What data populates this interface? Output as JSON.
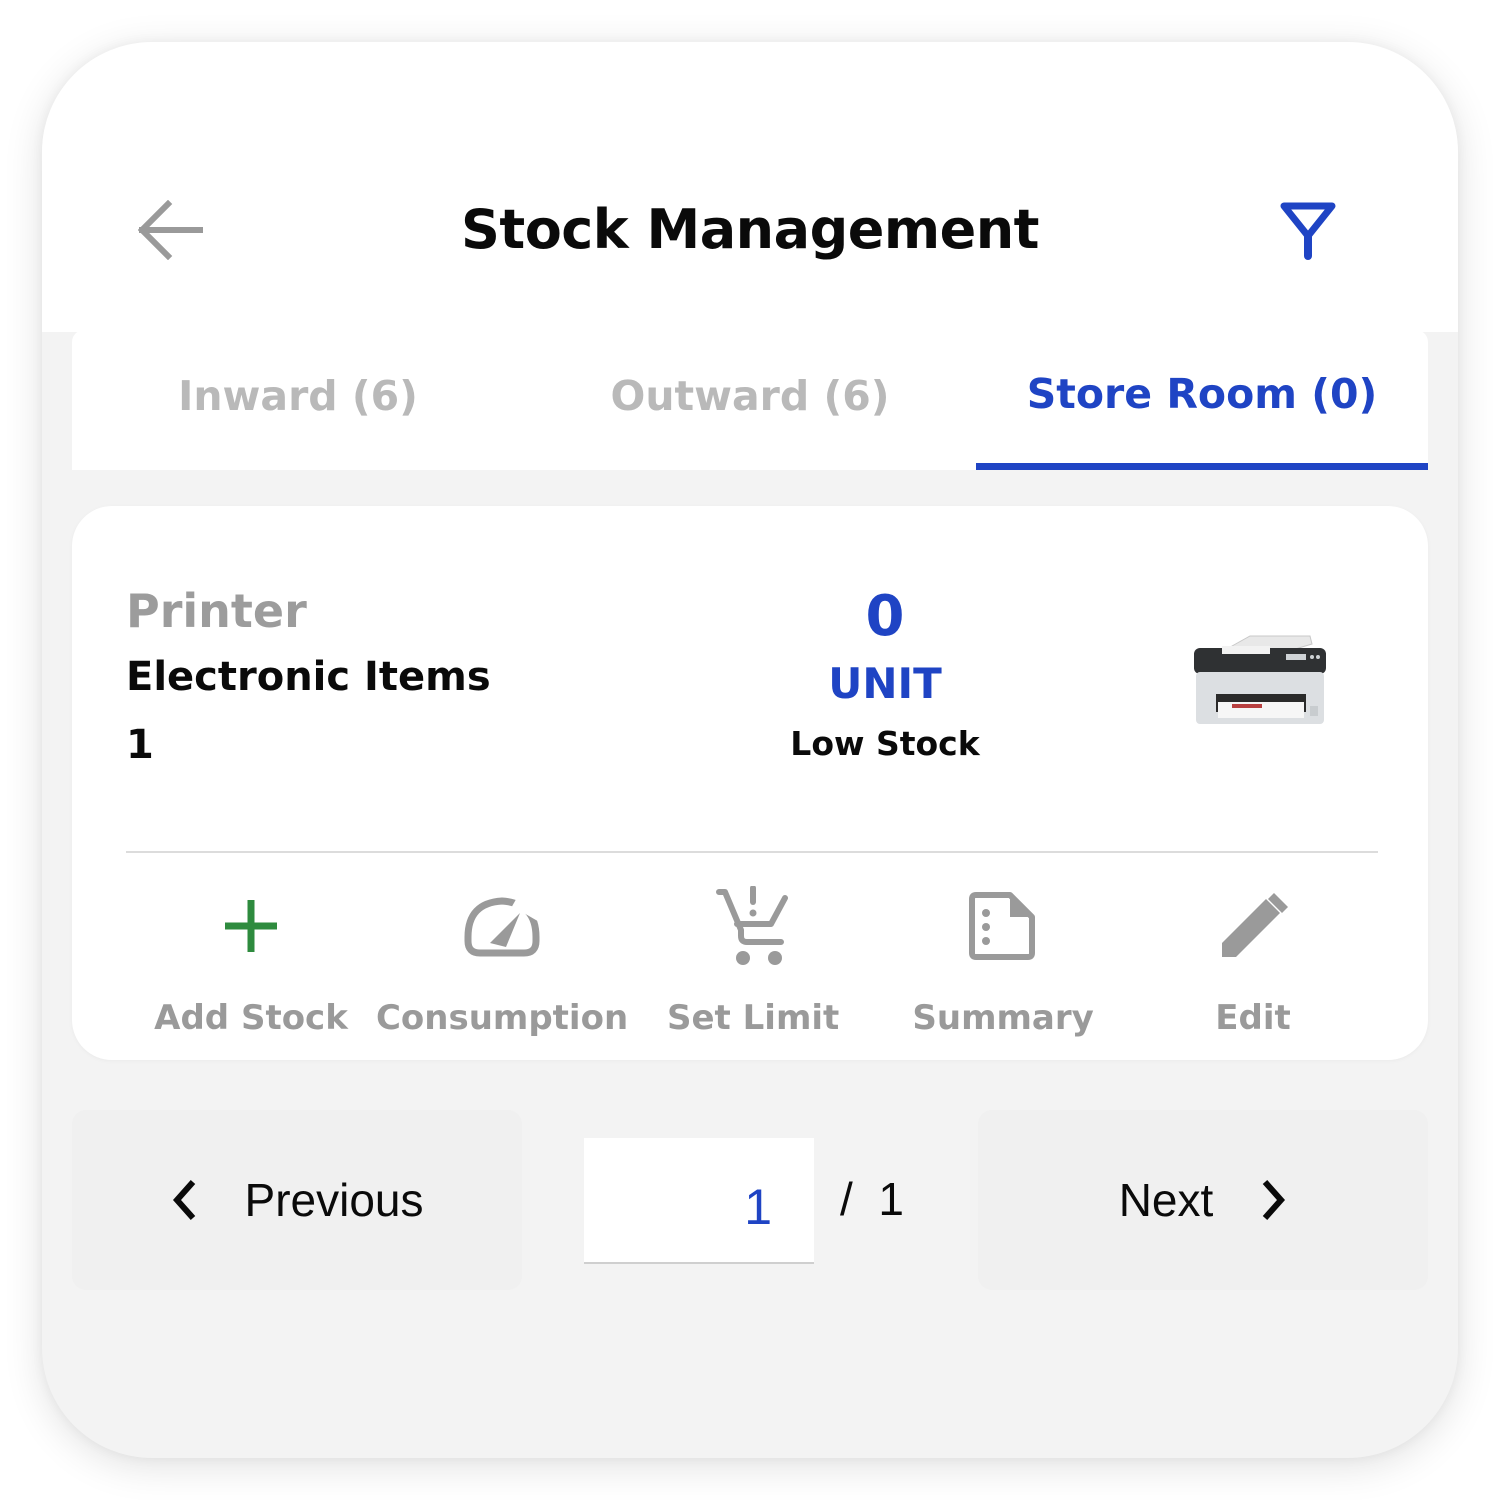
{
  "header": {
    "title": "Stock Management",
    "back_icon": "arrow-left-icon",
    "filter_icon": "filter-icon"
  },
  "tabs": [
    {
      "label": "Inward (6)",
      "active": false
    },
    {
      "label": "Outward (6)",
      "active": false
    },
    {
      "label": "Store Room (0)",
      "active": true
    }
  ],
  "item": {
    "name": "Printer",
    "category": "Electronic Items",
    "number": "1",
    "quantity": "0",
    "unit": "UNIT",
    "status": "Low Stock",
    "image_alt": "printer-image"
  },
  "actions": [
    {
      "label": "Add Stock",
      "icon": "plus-icon",
      "color": "#2e8b3e"
    },
    {
      "label": "Consumption",
      "icon": "speedometer-icon",
      "color": "#9a9a9a"
    },
    {
      "label": "Set Limit",
      "icon": "cart-alert-icon",
      "color": "#9a9a9a"
    },
    {
      "label": "Summary",
      "icon": "document-icon",
      "color": "#9a9a9a"
    },
    {
      "label": "Edit",
      "icon": "pencil-icon",
      "color": "#9a9a9a"
    }
  ],
  "pagination": {
    "previous_label": "Previous",
    "next_label": "Next",
    "current_page": "1",
    "total_text": "/  1"
  },
  "colors": {
    "accent": "#1f44c4",
    "add_green": "#2e8b3e",
    "muted": "#9a9a9a"
  }
}
